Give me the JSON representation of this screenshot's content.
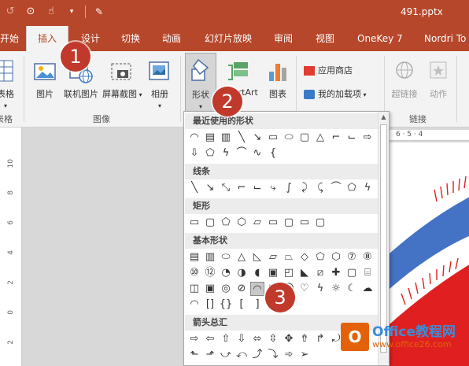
{
  "titlebar": {
    "doc_title": "491.pptx",
    "qat": [
      "undo-icon",
      "present-icon",
      "touch-icon",
      "dropdown-icon",
      "pen-icon"
    ]
  },
  "tabs": [
    "开始",
    "插入",
    "设计",
    "切换",
    "动画",
    "幻灯片放映",
    "审阅",
    "视图",
    "OneKey 7",
    "Nordri To"
  ],
  "active_tab": "插入",
  "ribbon": {
    "table": {
      "label": "表格",
      "group": "表格"
    },
    "images": {
      "items": [
        "图片",
        "联机图片",
        "屏幕截图",
        "相册"
      ],
      "group": "图像"
    },
    "illustrations": {
      "shapes": "形状",
      "smartart": "SmartArt",
      "chart": "图表"
    },
    "addins": {
      "store": "应用商店",
      "my_addins": "我的加载项"
    },
    "links": {
      "link": "超链接",
      "action": "动作",
      "group": "链接"
    }
  },
  "dropdown": {
    "sections": [
      "最近使用的形状",
      "线条",
      "矩形",
      "基本形状",
      "箭头总汇"
    ]
  },
  "ruler": {
    "h_mark": "6 · 5 · 4",
    "v_marks": [
      "10",
      "8",
      "6",
      "4",
      "2",
      "0",
      "2"
    ]
  },
  "callouts": [
    "1",
    "2",
    "3"
  ],
  "watermark": {
    "name": "Office教程网",
    "url": "www.office26.com"
  },
  "colors": {
    "brand": "#b7472a",
    "callout": "#c0392b",
    "slide_blue": "#4472c4",
    "slide_red": "#e02020"
  }
}
